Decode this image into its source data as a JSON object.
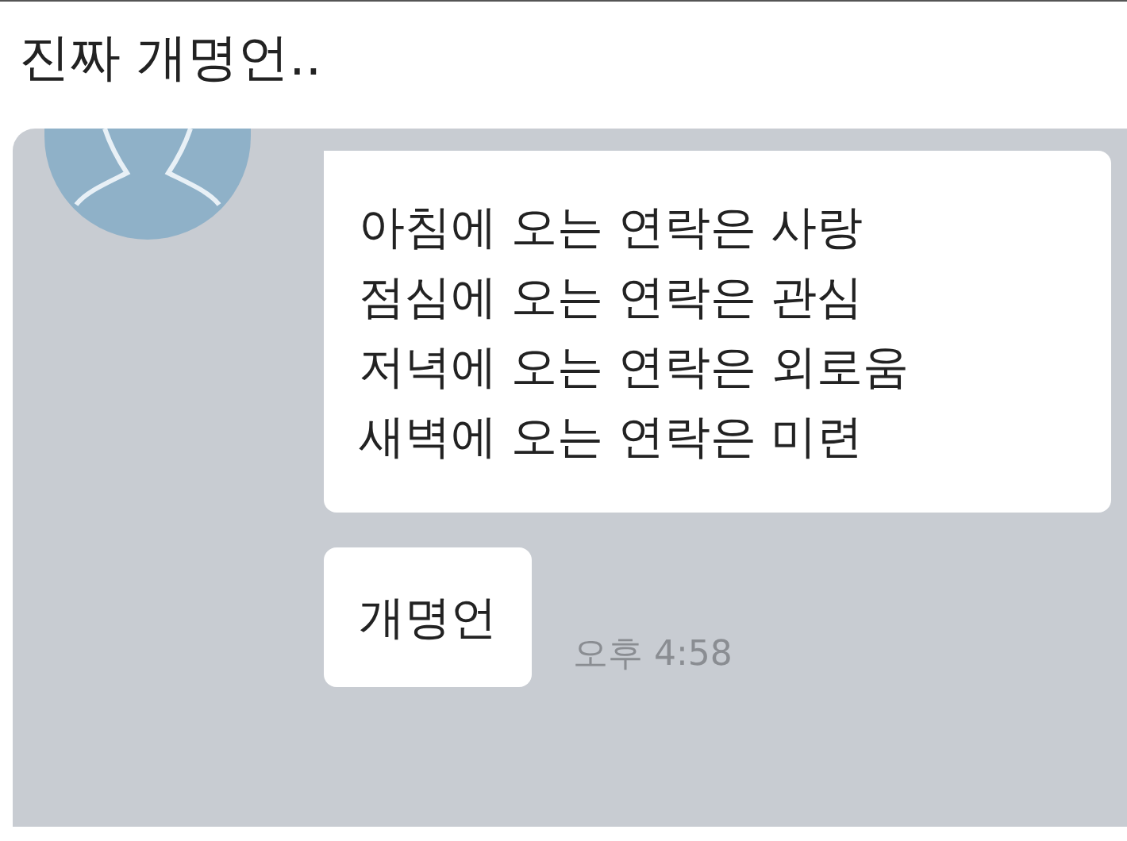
{
  "post_title": "진짜 개명언..",
  "messages": [
    {
      "lines": [
        "아침에 오는 연락은 사랑",
        "점심에 오는 연락은 관심",
        "저녁에 오는 연락은 외로움",
        "새벽에 오는 연락은 미련"
      ]
    },
    {
      "lines": [
        "개명언"
      ]
    }
  ],
  "time": "오후 4:58"
}
